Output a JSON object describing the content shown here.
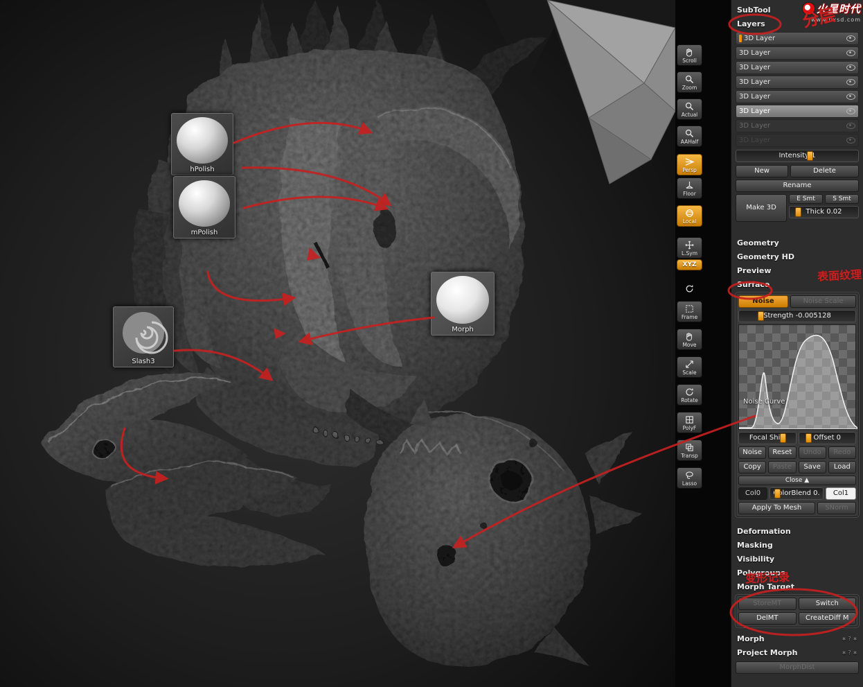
{
  "watermark": {
    "brand": "火星时代",
    "site": "www.hxsd.com"
  },
  "canvas": {
    "brushes": [
      {
        "label": "hPolish"
      },
      {
        "label": "mPolish"
      },
      {
        "label": "Slash3"
      },
      {
        "label": "Morph"
      }
    ],
    "annotations": {
      "layers_note": "分层",
      "surface_note": "表面纹理",
      "morph_note": "变形记录"
    }
  },
  "toolbar": {
    "buttons": [
      {
        "label": "Scroll",
        "icon": "hand-icon"
      },
      {
        "label": "Zoom",
        "icon": "magnifier-icon"
      },
      {
        "label": "Actual",
        "icon": "magnifier-icon"
      },
      {
        "label": "AAHalf",
        "icon": "magnifier-icon"
      },
      {
        "label": "Persp",
        "icon": "perspective-icon",
        "active": true
      },
      {
        "label": "Floor",
        "icon": "floor-grid-icon"
      },
      {
        "label": "Local",
        "icon": "sphere-icon",
        "active": true
      },
      {
        "label": "L.Sym",
        "icon": "axes-icon"
      },
      {
        "label": "XYZ",
        "icon": "",
        "active": true
      },
      {
        "label": "",
        "icon": "spiral-icon"
      },
      {
        "label": "Frame",
        "icon": "frame-icon"
      },
      {
        "label": "Move",
        "icon": "hand-icon"
      },
      {
        "label": "Scale",
        "icon": "scale-icon"
      },
      {
        "label": "Rotate",
        "icon": "rotate-icon"
      },
      {
        "label": "PolyF",
        "icon": "polyframe-icon"
      },
      {
        "label": "Transp",
        "icon": "transparency-icon"
      },
      {
        "label": "Lasso",
        "icon": "lasso-icon"
      }
    ]
  },
  "panel": {
    "subtool": "SubTool",
    "layers": {
      "title": "Layers",
      "rows": [
        {
          "label": "3D Layer"
        },
        {
          "label": "3D Layer"
        },
        {
          "label": "3D Layer"
        },
        {
          "label": "3D Layer"
        },
        {
          "label": "3D Layer"
        },
        {
          "label": "3D Layer"
        },
        {
          "label": "3D Layer"
        },
        {
          "label": "3D Layer"
        }
      ],
      "intensity": "Intensity 1",
      "new": "New",
      "delete": "Delete",
      "rename": "Rename",
      "make3d": "Make 3D",
      "e_smt": "E Smt",
      "s_smt": "S Smt",
      "thick": "Thick 0.02"
    },
    "headers": {
      "geometry": "Geometry",
      "geometry_hd": "Geometry HD",
      "preview": "Preview",
      "surface": "Surface",
      "deformation": "Deformation",
      "masking": "Masking",
      "visibility": "Visibility",
      "polygroups": "Polygroups",
      "morph_target": "Morph Target",
      "morph": "Morph"
    },
    "noise": {
      "noise_btn": "Noise",
      "noise_scale": "Noise Scale",
      "strength": "Strength -0.005128",
      "curve_label": "Noise Curve",
      "focal_shift": "Focal Shift",
      "offset": "Offset 0",
      "noise2": "Noise",
      "reset": "Reset",
      "undo": "Undo",
      "redo": "Redo",
      "copy": "Copy",
      "paste": "Paste",
      "save": "Save",
      "load": "Load",
      "close": "Close ▲",
      "col0": "Col0",
      "colorblend": "ColorBlend 0.",
      "col1": "Col1",
      "apply": "Apply To Mesh",
      "snorm": "SNorm"
    },
    "morph_target": {
      "storemt": "StoreMT",
      "switch": "Switch",
      "delmt": "DelMT",
      "creatediff": "CreateDiff M"
    },
    "morph": {
      "project": "Project Morph",
      "morphdist": "MorphDist",
      "hotkeys": "∗ ? ∗"
    }
  }
}
